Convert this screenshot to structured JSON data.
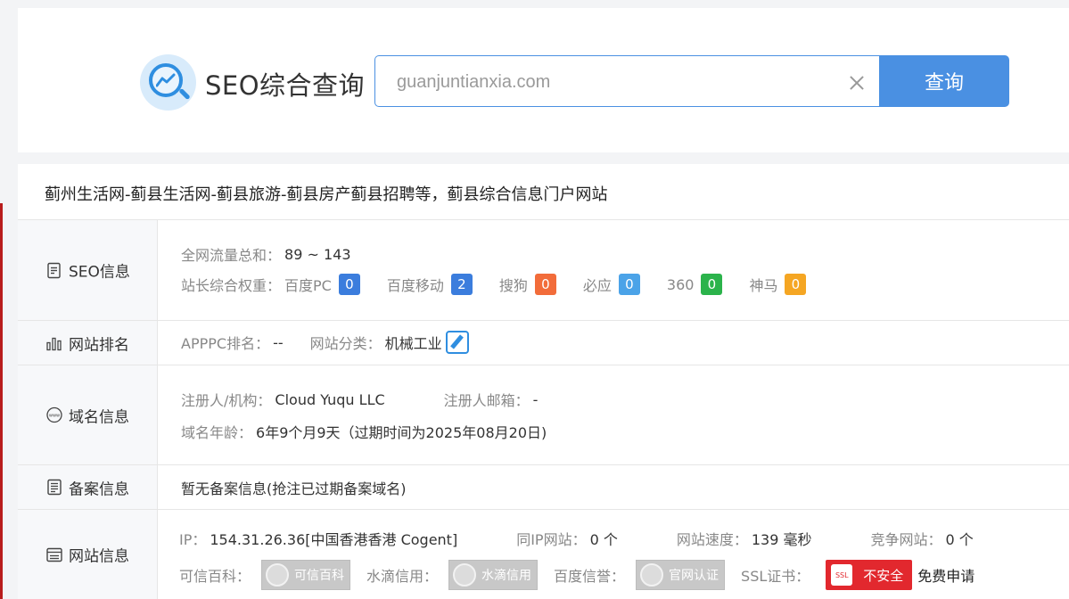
{
  "search": {
    "brand_title": "SEO综合查询",
    "input_value": "guanjuntianxia.com",
    "button_label": "查询"
  },
  "site": {
    "title": "蓟州生活网-蓟县生活网-蓟县旅游-蓟县房产蓟县招聘等，蓟县综合信息门户网站"
  },
  "seo_info": {
    "label": "SEO信息",
    "traffic_key": "全网流量总和：",
    "traffic_value": "89 ~ 143",
    "weight_key": "站长综合权重：",
    "weights": [
      {
        "name": "百度PC",
        "value": "0",
        "color": "#3b7ddd"
      },
      {
        "name": "百度移动",
        "value": "2",
        "color": "#3b7ddd"
      },
      {
        "name": "搜狗",
        "value": "0",
        "color": "#f26c3a"
      },
      {
        "name": "必应",
        "value": "0",
        "color": "#4ba3e8"
      },
      {
        "name": "360",
        "value": "0",
        "color": "#2bb34b"
      },
      {
        "name": "神马",
        "value": "0",
        "color": "#f5a623"
      }
    ]
  },
  "ranking": {
    "label": "网站排名",
    "apppc_key": "APPPC排名：",
    "apppc_value": "--",
    "category_key": "网站分类：",
    "category_value": "机械工业"
  },
  "domain": {
    "label": "域名信息",
    "registrant_key": "注册人/机构：",
    "registrant_value": "Cloud Yuqu LLC",
    "email_key": "注册人邮箱：",
    "email_value": "-",
    "age_key": "域名年龄：",
    "age_value": "6年9个月9天（过期时间为2025年08月20日)"
  },
  "beian": {
    "label": "备案信息",
    "value": "暂无备案信息(抢注已过期备案域名)"
  },
  "website": {
    "label": "网站信息",
    "ip_key": "IP：",
    "ip_value": "154.31.26.36[中国香港香港 Cogent]",
    "same_ip_key": "同IP网站：",
    "same_ip_value": "0 个",
    "speed_key": "网站速度：",
    "speed_value": "139 毫秒",
    "competitor_key": "竞争网站：",
    "competitor_value": "0 个",
    "kexin_key": "可信百科：",
    "kexin_badge": "可信百科",
    "shuidi_key": "水滴信用：",
    "shuidi_badge": "水滴信用",
    "baidu_key": "百度信誉：",
    "baidu_badge": "官网认证",
    "ssl_key": "SSL证书：",
    "ssl_badge": "不安全",
    "ssl_icon_text": "SSL",
    "ssl_apply": "免费申请"
  }
}
